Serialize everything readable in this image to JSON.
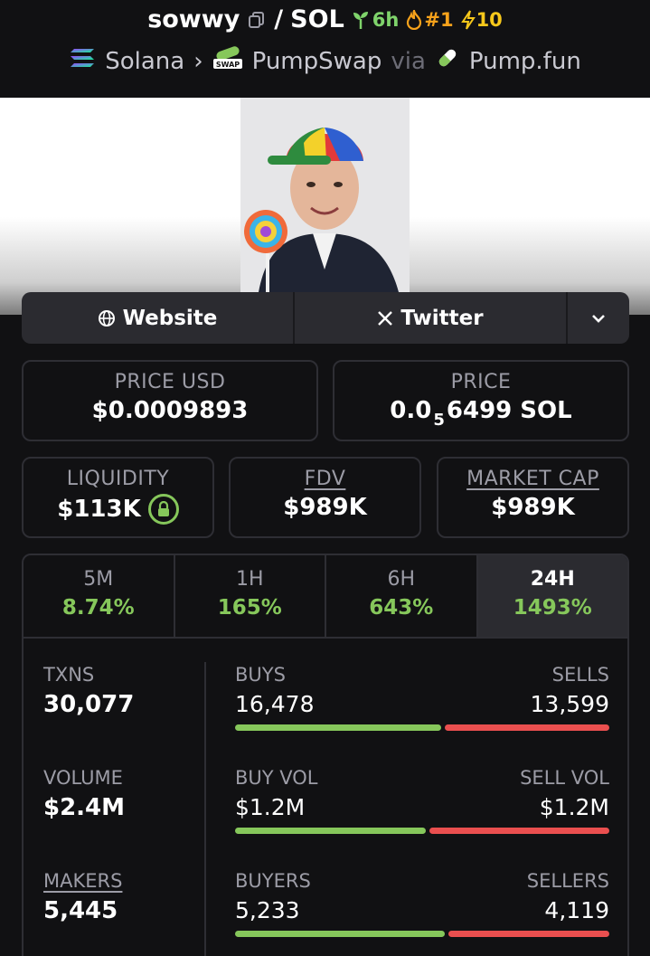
{
  "header": {
    "token_name": "sowwy",
    "separator": "/",
    "quote": "SOL",
    "age": "6h",
    "rank": "#1",
    "boosts": "10",
    "chain": "Solana",
    "dex": "PumpSwap",
    "dex_badge": "SWAP",
    "via": "via",
    "launchpad": "Pump.fun"
  },
  "links": {
    "website": "Website",
    "twitter": "Twitter"
  },
  "price": {
    "usd_label": "PRICE USD",
    "usd_value": "$0.0009893",
    "native_label": "PRICE",
    "native_prefix": "0.0",
    "native_subscript": "5",
    "native_rest": "6499 SOL"
  },
  "caps": {
    "liquidity_label": "LIQUIDITY",
    "liquidity_value": "$113K",
    "fdv_label": "FDV",
    "fdv_value": "$989K",
    "mcap_label": "MARKET CAP",
    "mcap_value": "$989K"
  },
  "tabs": [
    {
      "label": "5M",
      "change": "8.74%"
    },
    {
      "label": "1H",
      "change": "165%"
    },
    {
      "label": "6H",
      "change": "643%"
    },
    {
      "label": "24H",
      "change": "1493%"
    }
  ],
  "metrics": {
    "txns_label": "TXNS",
    "txns_value": "30,077",
    "volume_label": "VOLUME",
    "volume_value": "$2.4M",
    "makers_label": "MAKERS",
    "makers_value": "5,445",
    "buys_label": "BUYS",
    "buys_value": "16,478",
    "sells_label": "SELLS",
    "sells_value": "13,599",
    "buyvol_label": "BUY VOL",
    "buyvol_value": "$1.2M",
    "sellvol_label": "SELL VOL",
    "sellvol_value": "$1.2M",
    "buyers_label": "BUYERS",
    "buyers_value": "5,233",
    "sellers_label": "SELLERS",
    "sellers_value": "4,119",
    "buy_ratio_txns": 0.55,
    "buy_ratio_vol": 0.51,
    "buy_ratio_makers": 0.56
  },
  "colors": {
    "green": "#86c75b",
    "red": "#ea4f4f",
    "accent_orange": "#f7a21b",
    "panel": "#2b2b30"
  }
}
